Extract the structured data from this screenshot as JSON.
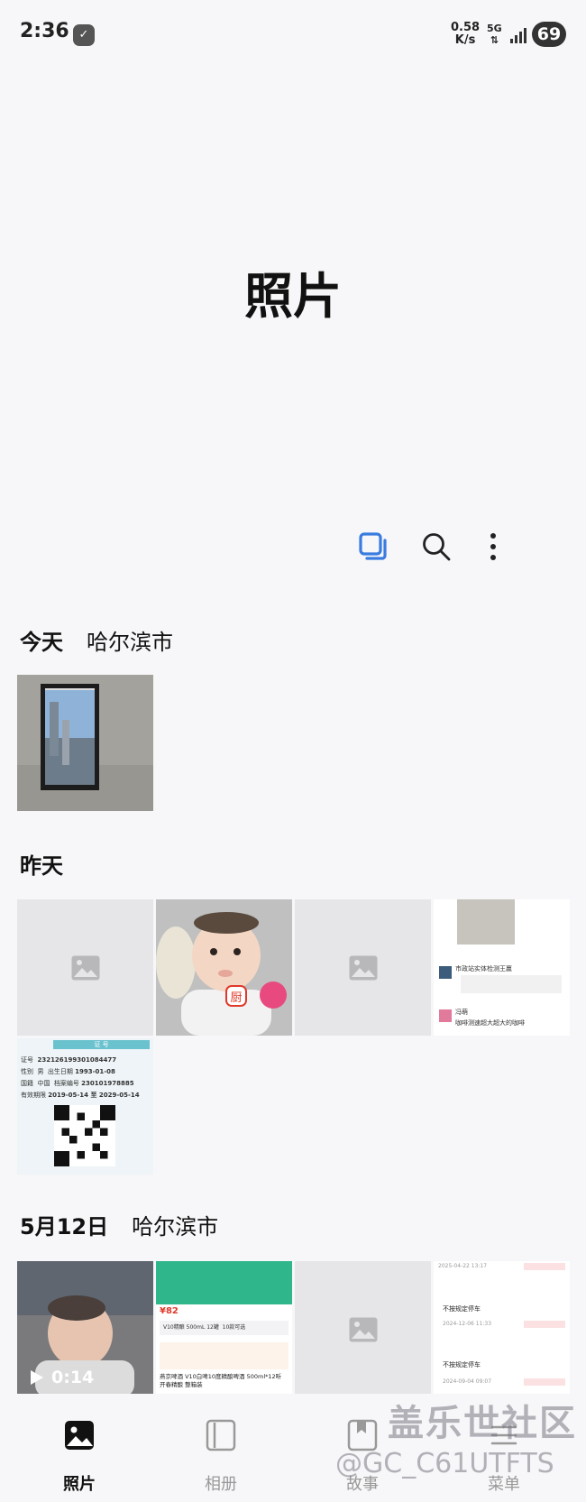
{
  "status_bar": {
    "time": "2:36",
    "net_speed_value": "0.58",
    "net_speed_unit": "K/s",
    "network": "5G",
    "battery": "69"
  },
  "header": {
    "title": "照片"
  },
  "toolbar": {
    "icons": [
      "multi-select-icon",
      "search-icon",
      "more-icon"
    ],
    "accent": "#3a7be0"
  },
  "sections": [
    {
      "date": "今天",
      "location": "哈尔滨市"
    },
    {
      "date": "昨天",
      "location": ""
    },
    {
      "date": "5月12日",
      "location": "哈尔滨市"
    }
  ],
  "thumbs": {
    "id_card": {
      "head": "证 号",
      "label_id": "证号",
      "id_number": "232126199301084477",
      "label_sex": "性别",
      "sex": "男",
      "label_birth": "出生日期",
      "birth": "1993-01-08",
      "label_nation": "国籍",
      "nation": "中国",
      "label_file": "档案编号",
      "file_no": "230101978885",
      "label_valid": "有效期限",
      "valid": "2019-05-14 至 2029-05-14"
    },
    "chat": {
      "line1": "市政站实体检测王赢",
      "line2": "冯萌",
      "line3": "咖啡测速超大超大的咖啡"
    },
    "shop": {
      "price": "¥82",
      "item1": "V10精酿 500mL 12罐",
      "item2": "10款可选",
      "item3": "燕京啤酒 V10白啤10度精酿啤酒 500ml*12听 开春精酿 整箱装"
    },
    "parking": {
      "date1": "2025-04-22 13:17",
      "title1": "不按规定停车",
      "date2": "2024-12-06 11:33",
      "title2": "不按规定停车",
      "date3": "2024-09-04 09:07"
    },
    "video_duration": "0:14"
  },
  "bottom_nav": [
    {
      "label": "照片",
      "active": true
    },
    {
      "label": "相册",
      "active": false
    },
    {
      "label": "故事",
      "active": false
    },
    {
      "label": "菜单",
      "active": false
    }
  ],
  "watermark": {
    "line1": "盖乐世社区",
    "line2": "@GC_C61UTFTS"
  }
}
